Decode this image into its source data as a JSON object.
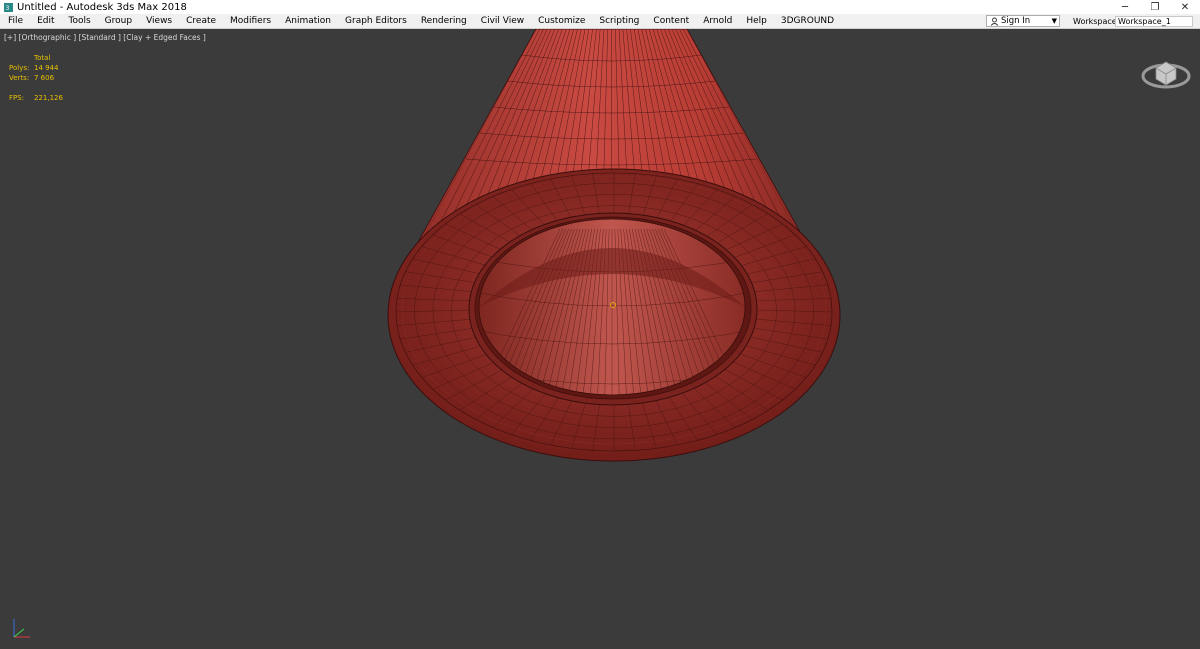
{
  "window": {
    "title": "Untitled - Autodesk 3ds Max 2018",
    "app_icon": "3ds-max-icon",
    "controls": {
      "minimize": "─",
      "restore": "❐",
      "close": "✕"
    }
  },
  "menu": {
    "items": [
      "File",
      "Edit",
      "Tools",
      "Group",
      "Views",
      "Create",
      "Modifiers",
      "Animation",
      "Graph Editors",
      "Rendering",
      "Civil View",
      "Customize",
      "Scripting",
      "Content",
      "Arnold",
      "Help",
      "3DGROUND"
    ],
    "sign_in": "Sign In",
    "workspaces_label": "Workspaces:",
    "workspace_value": "Workspace_1"
  },
  "viewport": {
    "label": "[+] [Orthographic ] [Standard ] [Clay + Edged Faces ]",
    "stats": {
      "header": "Total",
      "polys_label": "Polys:",
      "polys_value": "14 944",
      "verts_label": "Verts:",
      "verts_value": "7 606",
      "fps_label": "FPS:",
      "fps_value": "221,126"
    },
    "colors": {
      "background": "#3b3b3b",
      "mesh_fill": "#c0453e",
      "mesh_dark": "#6e1b17",
      "wire": "#3a0e0c",
      "stats_text": "#e8c000"
    }
  }
}
